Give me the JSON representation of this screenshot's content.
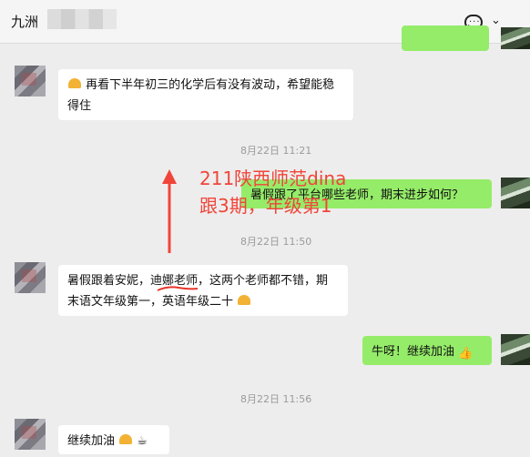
{
  "header": {
    "title": "九洲"
  },
  "messages": [
    {
      "side": "left",
      "text_pre_icon": "",
      "text": "再看下半年初三的化学后有没有波动，希望能稳得住"
    },
    {
      "time": "8月22日 11:21"
    },
    {
      "side": "right",
      "text": "暑假跟了平台哪些老师，期末进步如何？"
    },
    {
      "time": "8月22日 11:50"
    },
    {
      "side": "left",
      "text": "暑假跟着安妮，迪娜老师，这两个老师都不错，期末语文年级第一，英语年级二十"
    },
    {
      "side": "right",
      "text": "牛呀！继续加油"
    },
    {
      "time": "8月22日 11:56"
    },
    {
      "side": "left",
      "text": "继续加油"
    }
  ],
  "annotation": {
    "line1": "211陕西师范dina",
    "line2": "跟3期，年级第1"
  },
  "colors": {
    "accent_green": "#95ec69",
    "annotation_red": "#f0453a"
  },
  "icons": [
    "chat-bubble-icon",
    "chevron-down-icon",
    "praying-hands-emoji",
    "thumbs-up-emoji",
    "coffee-emoji"
  ]
}
